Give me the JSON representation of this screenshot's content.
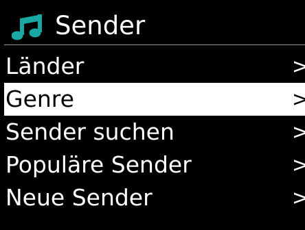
{
  "header": {
    "title": "Sender",
    "icon": "music-note-icon",
    "icon_color": "#19a9a2"
  },
  "menu": {
    "items": [
      {
        "label": "Länder",
        "arrow": ">",
        "selected": false
      },
      {
        "label": "Genre",
        "arrow": ">",
        "selected": true
      },
      {
        "label": "Sender suchen",
        "arrow": ">",
        "selected": false
      },
      {
        "label": "Populäre Sender",
        "arrow": ">",
        "selected": false
      },
      {
        "label": "Neue Sender",
        "arrow": ">",
        "selected": false
      }
    ]
  },
  "colors": {
    "background": "#000000",
    "text": "#ffffff",
    "highlight_background": "#ffffff",
    "highlight_text": "#000000"
  }
}
